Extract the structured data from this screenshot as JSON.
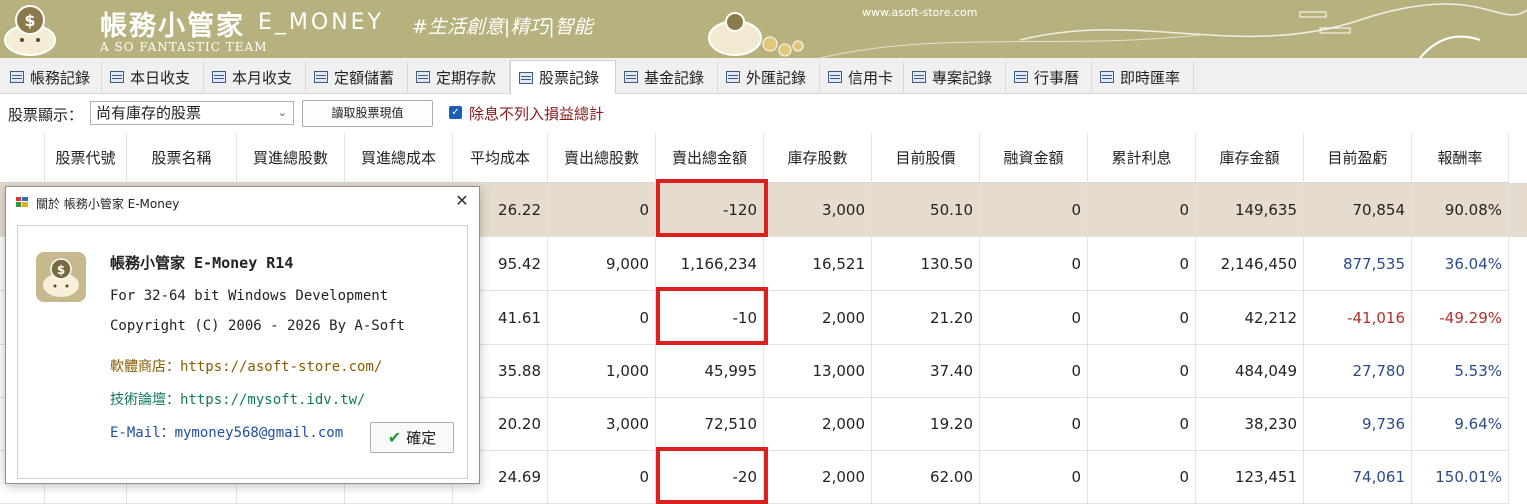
{
  "banner": {
    "title": "帳務小管家",
    "title_en": "E_MONEY",
    "team": "A SO FANTASTIC TEAM",
    "slogan": "#生活創意|精巧|智能",
    "url": "www.asoft-store.com"
  },
  "tabs": [
    {
      "label": "帳務記錄",
      "active": false
    },
    {
      "label": "本日收支",
      "active": false
    },
    {
      "label": "本月收支",
      "active": false
    },
    {
      "label": "定額儲蓄",
      "active": false
    },
    {
      "label": "定期存款",
      "active": false
    },
    {
      "label": "股票記錄",
      "active": true
    },
    {
      "label": "基金記錄",
      "active": false
    },
    {
      "label": "外匯記錄",
      "active": false
    },
    {
      "label": "信用卡",
      "active": false
    },
    {
      "label": "專案記錄",
      "active": false
    },
    {
      "label": "行事曆",
      "active": false
    },
    {
      "label": "即時匯率",
      "active": false
    }
  ],
  "toolbar": {
    "filter_label": "股票顯示：",
    "filter_value": "尚有庫存的股票",
    "fetch_button": "讀取股票現值",
    "dividend_checkbox_label": "除息不列入損益總計",
    "dividend_checked": true
  },
  "columns": [
    "股票代號",
    "股票名稱",
    "買進總股數",
    "買進總成本",
    "平均成本",
    "賣出總股數",
    "賣出總金額",
    "庫存股數",
    "目前股價",
    "融資金額",
    "累計利息",
    "庫存金額",
    "目前盈虧",
    "報酬率"
  ],
  "rows": [
    {
      "avg_cost": "26.22",
      "sell_shares": "0",
      "sell_amount": "-120",
      "stock_shares": "3,000",
      "price": "50.10",
      "margin": "0",
      "interest": "0",
      "stock_value": "149,635",
      "pl": "70,854",
      "roi": "90.08%",
      "sign": "sel",
      "highlight": true
    },
    {
      "avg_cost": "95.42",
      "sell_shares": "9,000",
      "sell_amount": "1,166,234",
      "stock_shares": "16,521",
      "price": "130.50",
      "margin": "0",
      "interest": "0",
      "stock_value": "2,146,450",
      "pl": "877,535",
      "roi": "36.04%",
      "sign": "pos",
      "highlight": false
    },
    {
      "avg_cost": "41.61",
      "sell_shares": "0",
      "sell_amount": "-10",
      "stock_shares": "2,000",
      "price": "21.20",
      "margin": "0",
      "interest": "0",
      "stock_value": "42,212",
      "pl": "-41,016",
      "roi": "-49.29%",
      "sign": "neg",
      "highlight": true
    },
    {
      "avg_cost": "35.88",
      "sell_shares": "1,000",
      "sell_amount": "45,995",
      "stock_shares": "13,000",
      "price": "37.40",
      "margin": "0",
      "interest": "0",
      "stock_value": "484,049",
      "pl": "27,780",
      "roi": "5.53%",
      "sign": "pos",
      "highlight": false
    },
    {
      "avg_cost": "20.20",
      "sell_shares": "3,000",
      "sell_amount": "72,510",
      "stock_shares": "2,000",
      "price": "19.20",
      "margin": "0",
      "interest": "0",
      "stock_value": "38,230",
      "pl": "9,736",
      "roi": "9.64%",
      "sign": "pos",
      "highlight": false
    },
    {
      "avg_cost": "24.69",
      "sell_shares": "0",
      "sell_amount": "-20",
      "stock_shares": "2,000",
      "price": "62.00",
      "margin": "0",
      "interest": "0",
      "stock_value": "123,451",
      "pl": "74,061",
      "roi": "150.01%",
      "sign": "pos",
      "highlight": true
    }
  ],
  "dialog": {
    "title": "關於 帳務小管家 E-Money",
    "product": "帳務小管家 E-Money R14",
    "dev": "For 32-64 bit Windows Development",
    "copyright": "Copyright (C) 2006 - 2026 By A-Soft",
    "shop": "軟體商店：https://asoft-store.com/",
    "forum": "技術論壇：https://mysoft.idv.tw/",
    "email": "E-Mail：mymoney568@gmail.com",
    "ok_label": "確定"
  },
  "colors": {
    "banner": "#b7b17e",
    "selected_row": "#e6dccd",
    "positive": "#2b4a8a",
    "negative": "#b0302a",
    "highlight_border": "#dd1f1f"
  }
}
